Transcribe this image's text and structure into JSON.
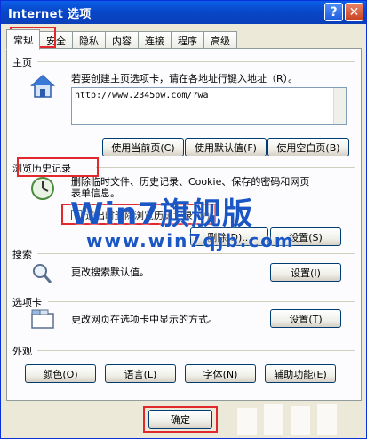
{
  "window": {
    "title": "Internet 选项",
    "help_label": "?",
    "close_label": "✕"
  },
  "tabs": [
    "常规",
    "安全",
    "隐私",
    "内容",
    "连接",
    "程序",
    "高级"
  ],
  "home": {
    "section": "主页",
    "description": "若要创建主页选项卡，请在各地址行键入地址（R）。",
    "url": "http://www.2345pw.com/?wa",
    "buttons": [
      "使用当前页(C)",
      "使用默认值(F)",
      "使用空白页(B)"
    ]
  },
  "history": {
    "section": "浏览历史记录",
    "description_line1": "删除临时文件、历史记录、Cookie、保存的密码和网页",
    "description_line2": "表单信息。",
    "checkbox_label": "退出时删除浏览历史记录(W)",
    "checkbox_checked": true,
    "delete_button": "删除(D)...",
    "settings_button": "设置(S)"
  },
  "search": {
    "section": "搜索",
    "description": "更改搜索默认值。",
    "settings_button": "设置(I)"
  },
  "tabs_section": {
    "section": "选项卡",
    "description": "更改网页在选项卡中显示的方式。",
    "settings_button": "设置(T)"
  },
  "appearance": {
    "section": "外观",
    "buttons": [
      "颜色(O)",
      "语言(L)",
      "字体(N)",
      "辅助功能(E)"
    ]
  },
  "footer": {
    "ok_button": "确定"
  },
  "watermark": {
    "logo": "Win7旗舰版",
    "url": "www.win7qjb.com"
  },
  "colors": {
    "title_bar": "#0a5fe8",
    "highlight": "#e0282d",
    "watermark": "#1a56c4"
  }
}
